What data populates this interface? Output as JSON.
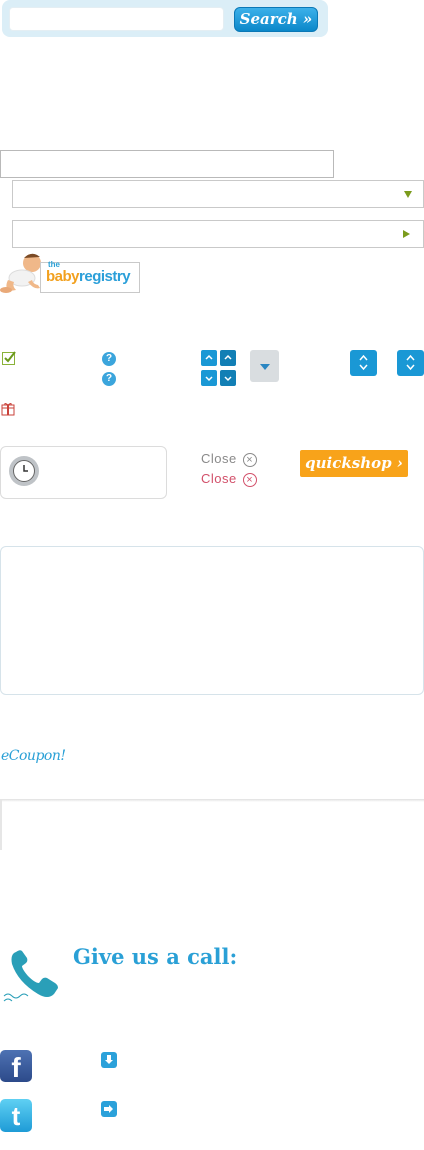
{
  "search": {
    "value": "",
    "button_label": "Search »"
  },
  "logo": {
    "the": "the",
    "brand_part1": "baby",
    "brand_part2": "registry"
  },
  "help_icons": [
    "?",
    "?"
  ],
  "close_links": [
    {
      "label": "Close",
      "color": "#8a8a8a"
    },
    {
      "label": "Close",
      "color": "#d2506a"
    }
  ],
  "quickshop": {
    "label": "quickshop ›"
  },
  "ecoupon": {
    "label": "eCoupon!"
  },
  "contact": {
    "call_label": "Give us a call:"
  },
  "social": {
    "facebook_glyph": "f",
    "twitter_glyph": "t"
  },
  "colors": {
    "accent_blue": "#2aa0d6",
    "accent_orange": "#f8a31a",
    "accent_green": "#7b9b1c"
  }
}
